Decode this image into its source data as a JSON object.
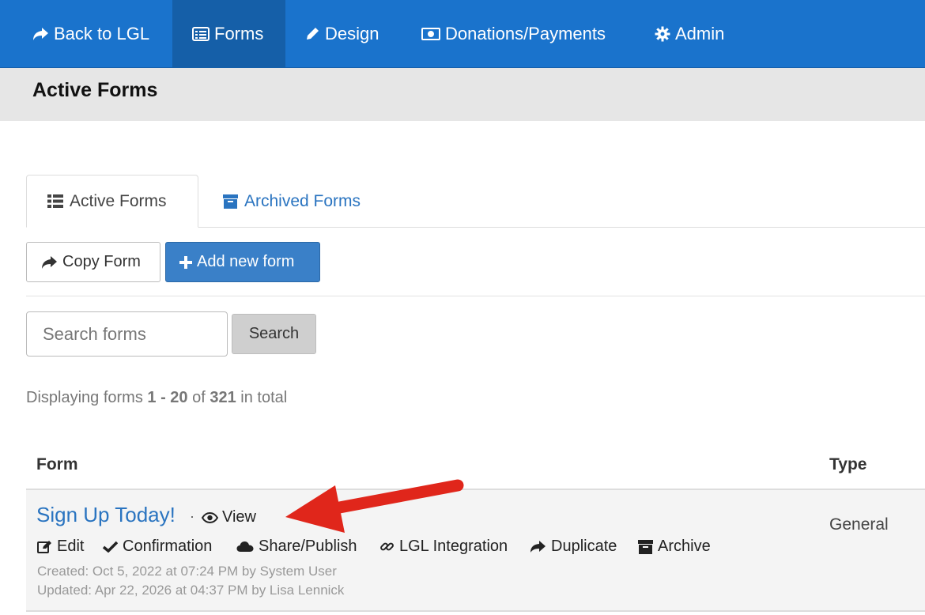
{
  "nav": {
    "items": [
      {
        "label": "Back to LGL"
      },
      {
        "label": "Forms"
      },
      {
        "label": "Design"
      },
      {
        "label": "Donations/Payments"
      },
      {
        "label": "Admin"
      }
    ],
    "active": "Forms",
    "color": "#1a73cc"
  },
  "page": {
    "title": "Active Forms"
  },
  "tabs": [
    {
      "label": "Active Forms",
      "active": true
    },
    {
      "label": "Archived Forms",
      "active": false
    }
  ],
  "toolbar": {
    "copy_label": "Copy Form",
    "add_label": "Add new form"
  },
  "search": {
    "placeholder": "Search forms",
    "button_label": "Search"
  },
  "count": {
    "prefix": "Displaying forms",
    "range": "1 - 20",
    "of": "of",
    "total": "321",
    "suffix": "in total"
  },
  "table": {
    "headers": {
      "form": "Form",
      "type": "Type"
    },
    "rows": [
      {
        "name": "Sign Up Today!",
        "separator": "·",
        "view_label": "View",
        "actions": {
          "edit": "Edit",
          "confirmation": "Confirmation",
          "share": "Share/Publish",
          "integration": "LGL Integration",
          "duplicate": "Duplicate",
          "archive": "Archive"
        },
        "created": "Created: Oct 5, 2022 at 07:24 PM by System User",
        "updated": "Updated: Apr 22, 2026 at 04:37 PM by Lisa Lennick",
        "type": "General"
      }
    ]
  },
  "annotation": {
    "arrow_color": "#e0261b"
  }
}
